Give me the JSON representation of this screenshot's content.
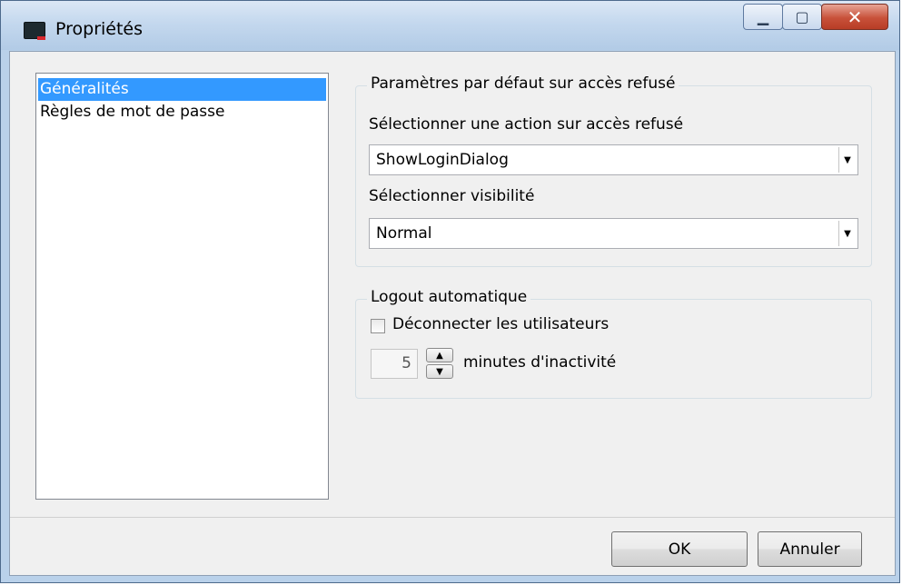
{
  "window": {
    "title": "Propriétés",
    "icon": "app-terminal-icon",
    "controls": {
      "minimize": "▁",
      "maximize": "▢",
      "close": "✕"
    }
  },
  "nav": {
    "items": [
      {
        "label": "Généralités",
        "selected": true
      },
      {
        "label": "Règles de mot de passe",
        "selected": false
      }
    ]
  },
  "access_denied": {
    "legend": "Paramètres par défaut sur accès refusé",
    "action_label": "Sélectionner une action sur accès refusé",
    "action_value": "ShowLoginDialog",
    "visibility_label": "Sélectionner visibilité",
    "visibility_value": "Normal",
    "dropdown_glyph": "▼"
  },
  "auto_logout": {
    "legend": "Logout automatique",
    "checkbox_label": "Déconnecter les utilisateurs",
    "checked": false,
    "minutes_value": "5",
    "minutes_label": "minutes d'inactivité",
    "spin_up_glyph": "▲",
    "spin_down_glyph": "▼"
  },
  "footer": {
    "ok_label": "OK",
    "cancel_label": "Annuler"
  },
  "colors": {
    "selection": "#3399ff",
    "window_frame": "#b9d1ea",
    "client_bg": "#f0f0f0",
    "close_button": "#c8513a"
  }
}
